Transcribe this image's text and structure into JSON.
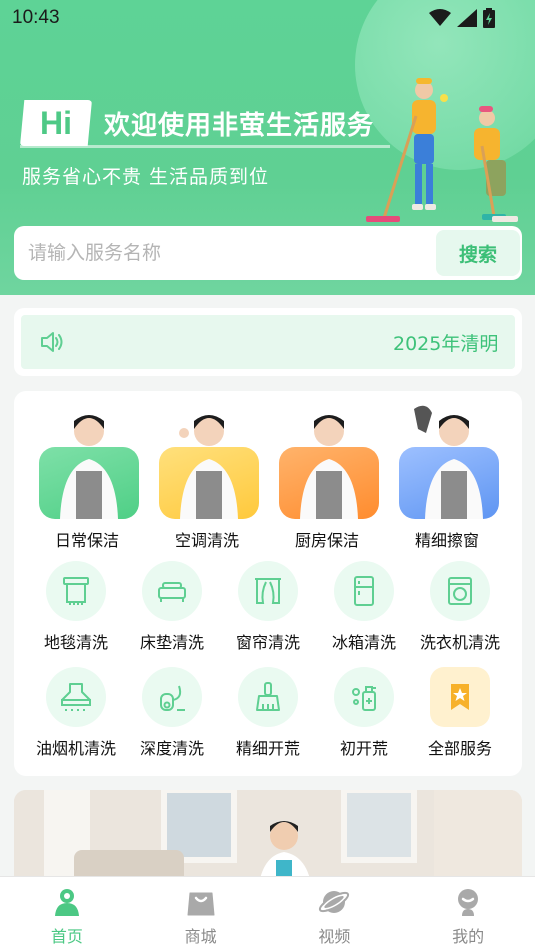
{
  "status_bar": {
    "time": "10:43"
  },
  "header": {
    "hi_badge": "Hi",
    "welcome": "欢迎使用非萤生活服务",
    "subtitle": "服务省心不贵 生活品质到位"
  },
  "search": {
    "placeholder": "请输入服务名称",
    "button": "搜索"
  },
  "notice": {
    "text": "2025年清明"
  },
  "featured_services": [
    {
      "label": "日常保洁",
      "bg": "#4fcf86"
    },
    {
      "label": "空调清洗",
      "bg": "#ffc93c"
    },
    {
      "label": "厨房保洁",
      "bg": "#ff8c2e"
    },
    {
      "label": "精细擦窗",
      "bg": "#5e95f2"
    }
  ],
  "services": [
    {
      "label": "地毯清洗",
      "icon": "carpet-icon"
    },
    {
      "label": "床垫清洗",
      "icon": "mattress-icon"
    },
    {
      "label": "窗帘清洗",
      "icon": "curtain-icon"
    },
    {
      "label": "冰箱清洗",
      "icon": "fridge-icon"
    },
    {
      "label": "洗衣机清洗",
      "icon": "washing-machine-icon"
    },
    {
      "label": "油烟机清洗",
      "icon": "range-hood-icon"
    },
    {
      "label": "深度清洗",
      "icon": "vacuum-icon"
    },
    {
      "label": "精细开荒",
      "icon": "brush-icon"
    },
    {
      "label": "初开荒",
      "icon": "spray-bottle-icon"
    },
    {
      "label": "全部服务",
      "icon": "star-icon"
    }
  ],
  "tabs": [
    {
      "label": "首页",
      "icon": "home-person-icon",
      "active": true
    },
    {
      "label": "商城",
      "icon": "shopping-bag-icon",
      "active": false
    },
    {
      "label": "视频",
      "icon": "planet-icon",
      "active": false
    },
    {
      "label": "我的",
      "icon": "profile-icon",
      "active": false
    }
  ],
  "colors": {
    "primary": "#5ed396",
    "accent_text": "#3ec27a",
    "icon_green": "#5fcf92"
  }
}
